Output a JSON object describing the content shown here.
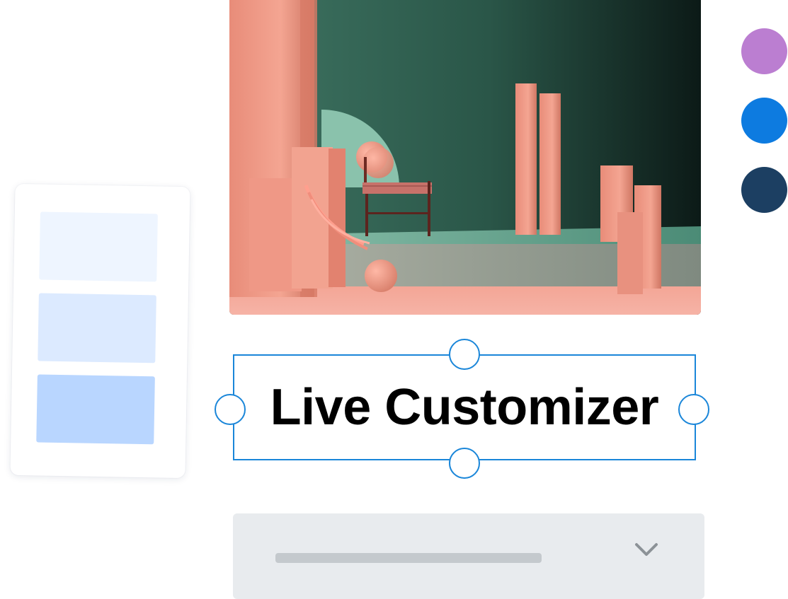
{
  "headline": {
    "text": "Live Customizer"
  },
  "swatches": [
    {
      "name": "purple",
      "color": "#bb7ed1"
    },
    {
      "name": "blue",
      "color": "#0d7be0"
    },
    {
      "name": "navy",
      "color": "#1c3f62"
    }
  ],
  "colors": {
    "selection": "#1a86d9",
    "layout_block_light": "#eef5ff",
    "layout_block_mid": "#dceaff",
    "layout_block_strong": "#b9d6ff",
    "dropdown_bg": "#e8ebee",
    "dropdown_bar": "#c4c9cd"
  },
  "icons": {
    "dropdown": "chevron-down-icon",
    "handles": "resize-handle"
  }
}
